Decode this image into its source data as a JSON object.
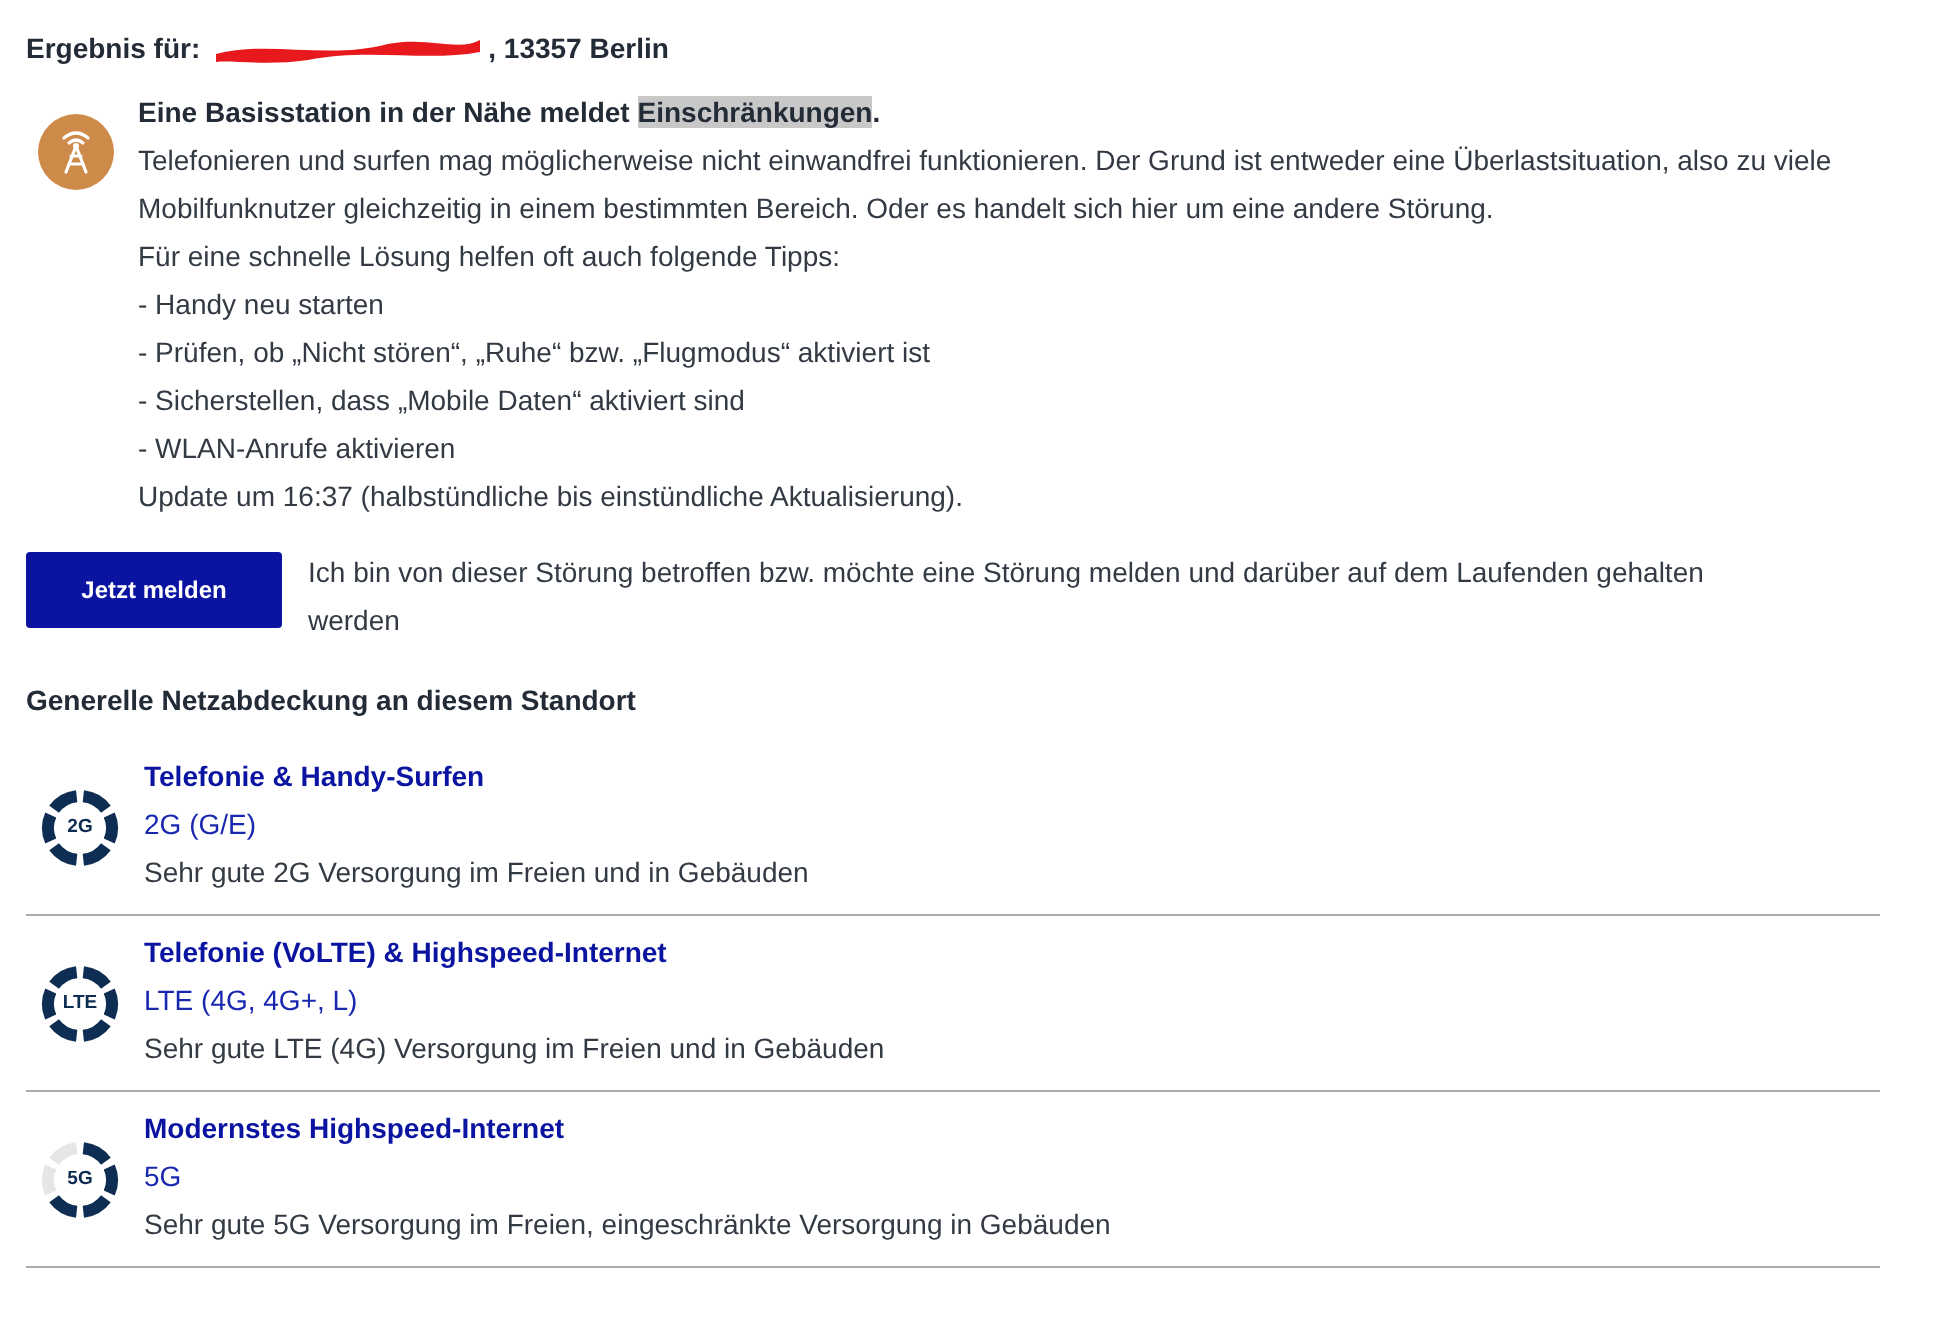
{
  "result": {
    "label": "Ergebnis für:",
    "redacted": true,
    "address": ", 13357 Berlin"
  },
  "notice": {
    "heading": [
      {
        "text": "Eine Basisstation in der Nähe meldet ",
        "highlighted": false
      },
      {
        "text": "Einschränkungen",
        "highlighted": true
      },
      {
        "text": ".",
        "highlighted": false
      }
    ],
    "lines": [
      "Telefonieren und surfen mag möglicherweise nicht einwandfrei funktionieren. Der Grund ist entweder eine Überlastsituation, also zu viele Mobilfunknutzer gleichzeitig in einem bestimmten Bereich. Oder es handelt sich hier um eine andere Störung.",
      "Für eine schnelle Lösung helfen oft auch folgende Tipps:",
      "- Handy neu starten",
      "- Prüfen, ob „Nicht stören“, „Ruhe“ bzw. „Flugmodus“ aktiviert ist",
      "- Sicherstellen, dass „Mobile Daten“ aktiviert sind",
      "- WLAN-Anrufe aktivieren",
      "Update um 16:37 (halbstündliche bis einstündliche Aktualisierung)."
    ]
  },
  "report": {
    "button": "Jetzt melden",
    "text": "Ich bin von dieser Störung betroffen bzw. möchte eine Störung melden und darüber auf dem Laufenden gehalten werden"
  },
  "coverage": {
    "title": "Generelle Netzabdeckung an diesem Standort",
    "items": [
      {
        "badge": "2G",
        "kind": "full",
        "title": "Telefonie & Handy-Surfen",
        "tech": "2G (G/E)",
        "description": "Sehr gute 2G Versorgung im Freien und in Gebäuden"
      },
      {
        "badge": "LTE",
        "kind": "full",
        "title": "Telefonie (VoLTE) & Highspeed-Internet",
        "tech": "LTE (4G, 4G+, L)",
        "description": "Sehr gute LTE (4G) Versorgung im Freien und in Gebäuden"
      },
      {
        "badge": "5G",
        "kind": "partial",
        "title": "Modernstes Highspeed-Internet",
        "tech": "5G",
        "description": "Sehr gute 5G Versorgung im Freien, eingeschränkte Versorgung in Gebäuden"
      }
    ]
  }
}
